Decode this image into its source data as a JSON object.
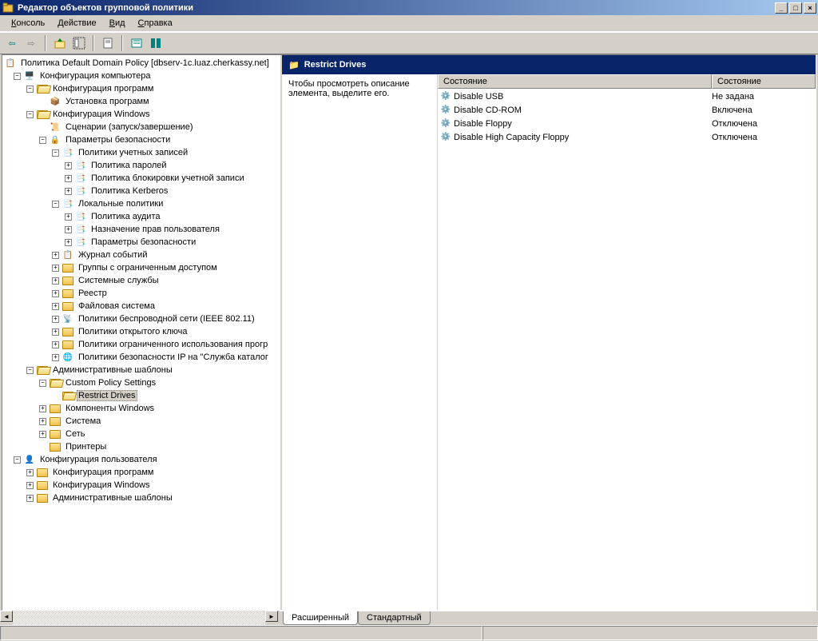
{
  "window": {
    "title": "Редактор объектов групповой политики"
  },
  "menubar": {
    "console": "Консоль",
    "action": "Действие",
    "view": "Вид",
    "help": "Справка"
  },
  "tree": {
    "root": "Политика Default Domain Policy [dbserv-1c.luaz.cherkassy.net]",
    "comp_config": "Конфигурация компьютера",
    "soft_config": "Конфигурация программ",
    "soft_install": "Установка программ",
    "win_config": "Конфигурация Windows",
    "scripts": "Сценарии (запуск/завершение)",
    "sec_params": "Параметры безопасности",
    "account_pol": "Политики учетных записей",
    "password_pol": "Политика паролей",
    "lockout_pol": "Политика блокировки учетной записи",
    "kerberos_pol": "Политика Kerberos",
    "local_pol": "Локальные политики",
    "audit_pol": "Политика аудита",
    "rights_assign": "Назначение прав пользователя",
    "sec_options": "Параметры безопасности",
    "event_log": "Журнал событий",
    "restricted_groups": "Группы с ограниченным доступом",
    "system_services": "Системные службы",
    "registry": "Реестр",
    "filesystem": "Файловая система",
    "wireless": "Политики беспроводной сети (IEEE 802.11)",
    "public_key": "Политики открытого ключа",
    "software_restrict": "Политики ограниченного использования прогр",
    "ipsec": "Политики безопасности IP на \"Служба каталог",
    "admin_templates": "Административные шаблоны",
    "custom_policy": "Custom Policy Settings",
    "restrict_drives": "Restrict Drives",
    "win_components": "Компоненты Windows",
    "system": "Система",
    "network": "Сеть",
    "printers": "Принтеры",
    "user_config": "Конфигурация пользователя",
    "user_soft": "Конфигурация программ",
    "user_win": "Конфигурация Windows",
    "user_admin": "Административные шаблоны"
  },
  "detail": {
    "header": "Restrict Drives",
    "description": "Чтобы просмотреть описание элемента, выделите его.",
    "col_state": "Состояние",
    "col_state2": "Состояние",
    "items": [
      {
        "name": "Disable USB",
        "state": "Не задана"
      },
      {
        "name": "Disable CD-ROM",
        "state": "Включена"
      },
      {
        "name": "Disable Floppy",
        "state": "Отключена"
      },
      {
        "name": "Disable High Capacity Floppy",
        "state": "Отключена"
      }
    ]
  },
  "tabs": {
    "extended": "Расширенный",
    "standard": "Стандартный"
  }
}
